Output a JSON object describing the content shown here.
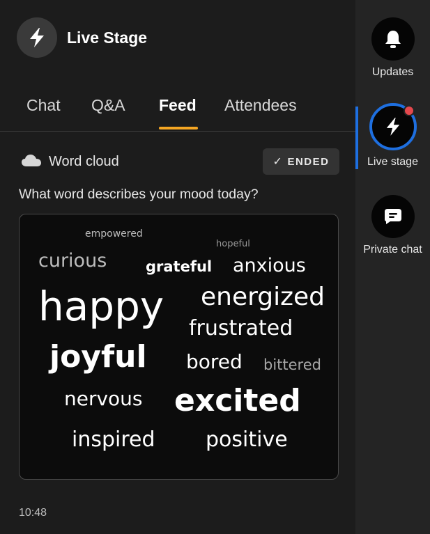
{
  "header": {
    "title": "Live Stage",
    "icon": "lightning-icon"
  },
  "tabs": [
    {
      "label": "Chat",
      "active": false
    },
    {
      "label": "Q&A",
      "active": false
    },
    {
      "label": "Feed",
      "active": true
    },
    {
      "label": "Attendees",
      "active": false
    }
  ],
  "feed": {
    "widget_label": "Word cloud",
    "status": "ENDED",
    "question": "What word describes your mood today?",
    "timestamp": "10:48",
    "words": [
      "empowered",
      "hopeful",
      "curious",
      "grateful",
      "anxious",
      "happy",
      "energized",
      "frustrated",
      "joyful",
      "bored",
      "bittered",
      "nervous",
      "excited",
      "inspired",
      "positive"
    ]
  },
  "rail": {
    "items": [
      {
        "label": "Updates",
        "icon": "bell-icon",
        "active": false
      },
      {
        "label": "Live stage",
        "icon": "lightning-icon",
        "active": true,
        "notification": true
      },
      {
        "label": "Private chat",
        "icon": "chat-bubble-icon",
        "active": false
      }
    ]
  },
  "colors": {
    "accent_tab": "#f5a623",
    "accent_active": "#1e6fe0",
    "notification": "#e5484d"
  }
}
